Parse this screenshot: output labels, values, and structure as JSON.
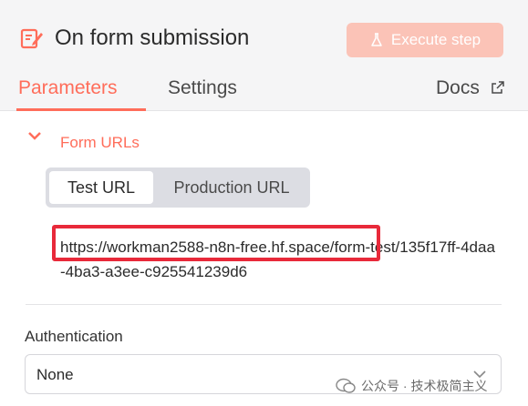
{
  "header": {
    "title": "On form submission",
    "execute_label": "Execute step",
    "icon": "form-edit-icon"
  },
  "tabs": [
    {
      "label": "Parameters"
    },
    {
      "label": "Settings"
    },
    {
      "label": "Docs"
    }
  ],
  "section": {
    "title": "Form URLs",
    "url_toggle": [
      "Test URL",
      "Production URL"
    ],
    "selected": "Test URL",
    "url": "https://workman2588-n8n-free.hf.space/form-test/135f17ff-4daa-4ba3-a3ee-c925541239d6"
  },
  "authentication": {
    "label": "Authentication",
    "value": "None"
  },
  "watermark": {
    "text": "公众号 · 技术极简主义"
  },
  "colors": {
    "accent": "#ff6d5a",
    "highlight": "#e8293a"
  }
}
